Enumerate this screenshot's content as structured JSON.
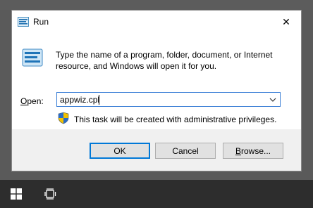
{
  "window": {
    "title": "Run",
    "close_symbol": "✕"
  },
  "dialog": {
    "description": "Type the name of a program, folder, document, or Internet resource, and Windows will open it for you.",
    "open_label_prefix": "O",
    "open_label_rest": "pen:",
    "input_value": "appwiz.cpl",
    "admin_note": "This task will be created with administrative privileges."
  },
  "buttons": {
    "ok": "OK",
    "cancel": "Cancel",
    "browse_prefix": "B",
    "browse_rest": "rowse..."
  },
  "icons": {
    "title": "run-icon",
    "graphic": "run-icon",
    "close": "close-icon",
    "dropdown": "chevron-down-icon",
    "shield": "uac-shield-icon",
    "start": "windows-logo-icon",
    "taskview": "task-view-icon"
  },
  "colors": {
    "accent": "#0078d7",
    "taskbar": "#2d2d2d",
    "desktop": "#5a5a5a"
  }
}
